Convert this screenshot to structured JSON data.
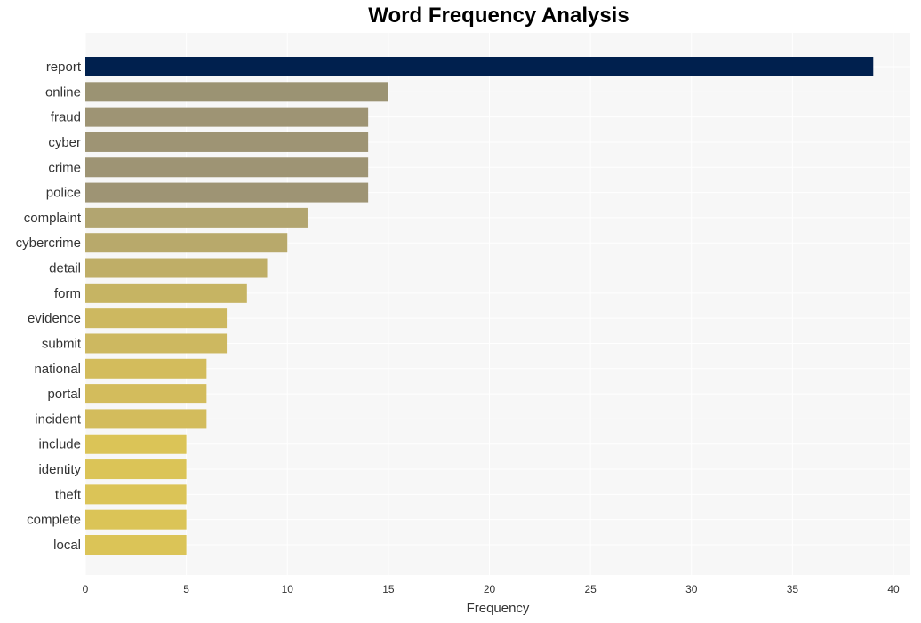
{
  "chart_data": {
    "type": "bar",
    "orientation": "horizontal",
    "title": "Word Frequency Analysis",
    "xlabel": "Frequency",
    "ylabel": "",
    "xlim": [
      0,
      40.8
    ],
    "xticks": [
      0,
      5,
      10,
      15,
      20,
      25,
      30,
      35,
      40
    ],
    "grid": true,
    "categories": [
      "report",
      "online",
      "fraud",
      "cyber",
      "crime",
      "police",
      "complaint",
      "cybercrime",
      "detail",
      "form",
      "evidence",
      "submit",
      "national",
      "portal",
      "incident",
      "include",
      "identity",
      "theft",
      "complete",
      "local"
    ],
    "values": [
      39,
      15,
      14,
      14,
      14,
      14,
      11,
      10,
      9,
      8,
      7,
      7,
      6,
      6,
      6,
      5,
      5,
      5,
      5,
      5
    ],
    "colors": [
      "#00204e",
      "#9b9373",
      "#9e9474",
      "#9e9474",
      "#9e9474",
      "#9e9474",
      "#b2a570",
      "#b8a96b",
      "#bfae67",
      "#c6b463",
      "#cdb860",
      "#cdb860",
      "#d3bc5c",
      "#d3bc5c",
      "#d3bc5c",
      "#dbc457",
      "#dbc457",
      "#dbc457",
      "#dbc457",
      "#dbc457"
    ],
    "background": "#f7f7f7"
  }
}
